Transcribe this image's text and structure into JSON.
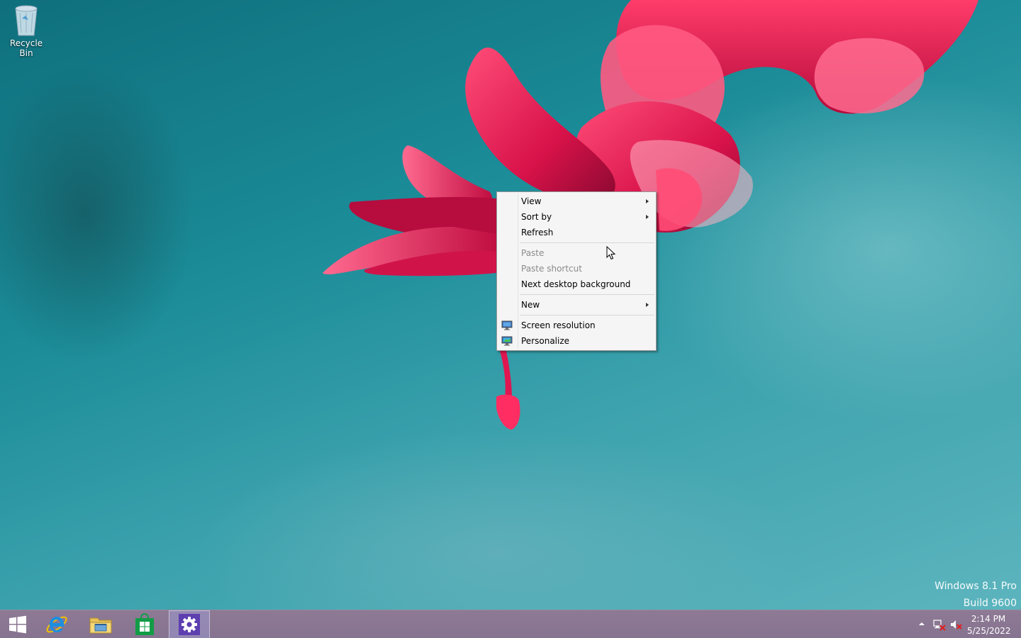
{
  "desktop": {
    "icons": [
      {
        "label": "Recycle Bin",
        "icon": "recycle-bin-icon"
      }
    ],
    "watermark": {
      "line1": "Windows 8.1 Pro",
      "line2": "Build 9600"
    }
  },
  "context_menu": {
    "items": {
      "view": {
        "label": "View",
        "submenu": true
      },
      "sort_by": {
        "label": "Sort by",
        "submenu": true
      },
      "refresh": {
        "label": "Refresh"
      },
      "paste": {
        "label": "Paste",
        "disabled": true
      },
      "paste_shortcut": {
        "label": "Paste shortcut",
        "disabled": true
      },
      "next_background": {
        "label": "Next desktop background"
      },
      "new": {
        "label": "New",
        "submenu": true
      },
      "screen_resolution": {
        "label": "Screen resolution",
        "icon": "monitor-icon"
      },
      "personalize": {
        "label": "Personalize",
        "icon": "personalize-icon"
      }
    }
  },
  "taskbar": {
    "buttons": [
      {
        "name": "start",
        "icon": "windows-logo-icon"
      },
      {
        "name": "internet-explorer",
        "icon": "ie-icon"
      },
      {
        "name": "file-explorer",
        "icon": "folder-icon"
      },
      {
        "name": "store",
        "icon": "store-icon"
      },
      {
        "name": "settings",
        "icon": "gear-icon",
        "active": true
      }
    ],
    "tray": {
      "icons": [
        "chevron-up-icon",
        "network-icon",
        "volume-muted-icon"
      ],
      "time": "2:14 PM",
      "date": "5/25/2022"
    }
  },
  "colors": {
    "taskbar": "#86738f",
    "menu_bg": "#f5f5f5",
    "active_task": "#a0a0dc",
    "flower": "#e0154d"
  }
}
